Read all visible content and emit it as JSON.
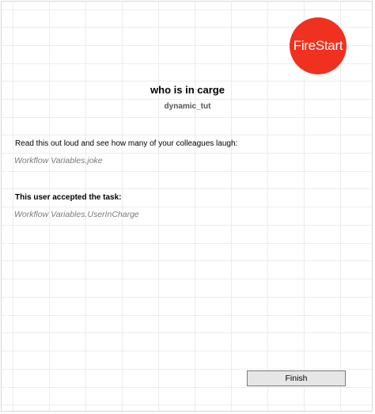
{
  "brand": {
    "logo_text": "FireStart",
    "logo_color": "#f0311f"
  },
  "form": {
    "title": "who is in carge",
    "subtitle": "dynamic_tut",
    "joke_label": "Read this out loud and see how many of your colleagues laugh:",
    "joke_value": "Workflow Variables.joke",
    "accepted_label": "This user accepted the task:",
    "accepted_value": "Workflow Variables.UserInCharge"
  },
  "actions": {
    "finish_label": "Finish"
  }
}
